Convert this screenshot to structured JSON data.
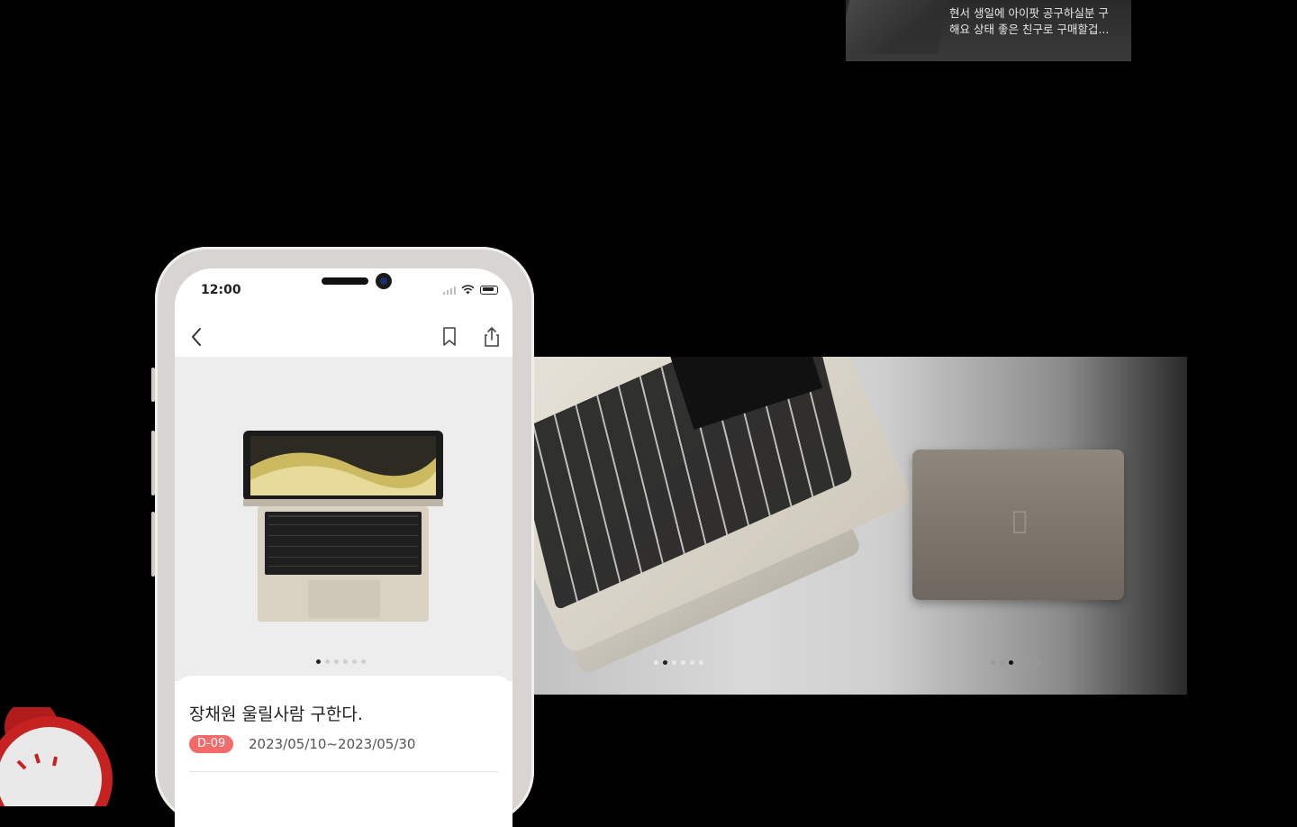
{
  "top_card": {
    "line1": "현서 생일에 아이팟 공구하실분 구",
    "line2": "해요 상태 좋은 친구로 구매할겁..."
  },
  "phone": {
    "status_time": "12:00",
    "listing_title": "장채원 울릴사람 구한다.",
    "dday_badge": "D-09",
    "date_range": "2023/05/10~2023/05/30",
    "gallery_active_index": 1,
    "gallery_count": 6
  },
  "banner": {
    "slide_a_active_index": 2,
    "slide_b_active_index": 3,
    "slide_count": 6
  },
  "colors": {
    "background": "#000000",
    "badge": "#f26a6a"
  },
  "icons": [
    "back-chevron-icon",
    "bookmark-icon",
    "share-icon",
    "wifi-icon",
    "battery-icon",
    "signal-icon",
    "apple-logo-icon"
  ]
}
